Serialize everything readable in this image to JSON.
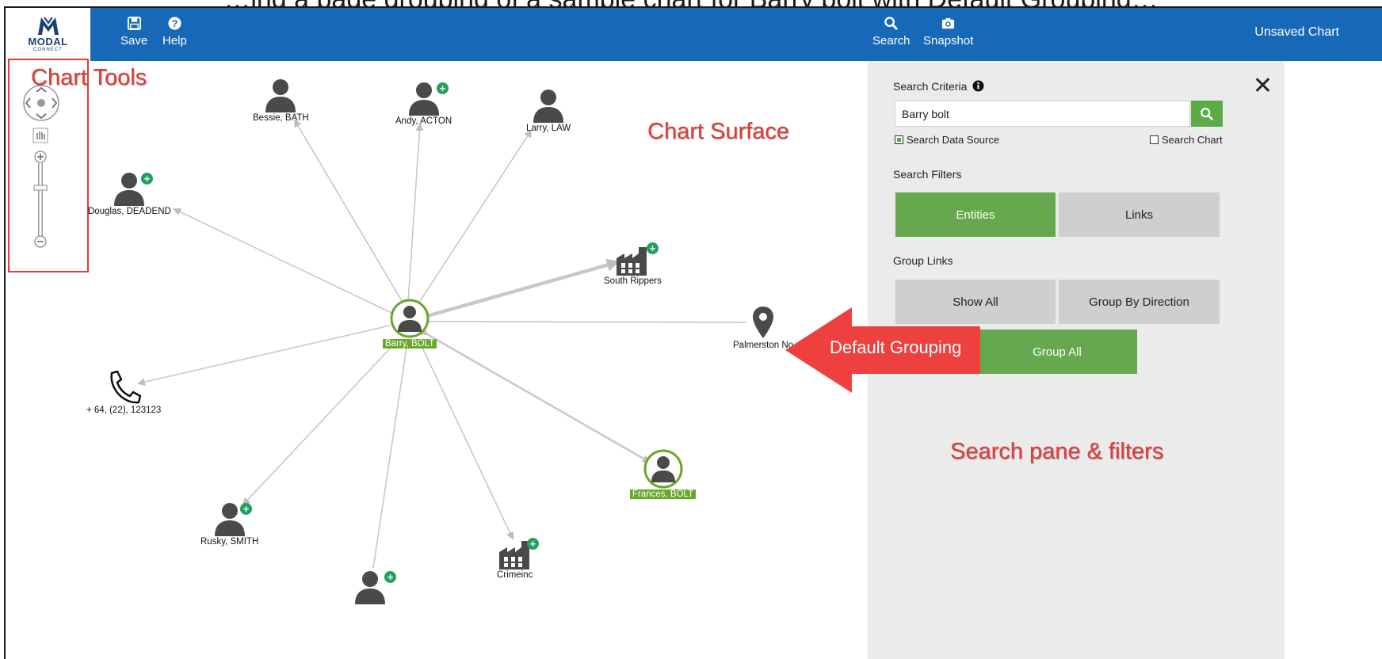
{
  "caption": "…ing a page grouping of a sample chart for Barry bolt with Default Grouping…",
  "app": {
    "logo_text": "MODAL",
    "logo_sub": "CONNECT",
    "chart_title": "Unsaved Chart"
  },
  "toolbar": {
    "save_label": "Save",
    "help_label": "Help",
    "search_label": "Search",
    "snapshot_label": "Snapshot"
  },
  "annotations": {
    "chart_tools": "Chart Tools",
    "chart_surface": "Chart Surface",
    "default_grouping": "Default Grouping",
    "search_pane": "Search pane & filters"
  },
  "nodes": {
    "barry": "Barry, BOLT",
    "bessie": "Bessie, BATH",
    "andy": "Andy, ACTON",
    "larry": "Larry, LAW",
    "douglas": "Douglas, DEADEND",
    "south_rippers": "South Rippers",
    "palmerston": "Palmerston No",
    "phone": "+ 64, (22), 123123",
    "frances": "Frances, BOLT",
    "rusky": "Rusky, SMITH",
    "crimeinc": "Crimeinc"
  },
  "search_pane": {
    "criteria_label": "Search Criteria",
    "query_value": "Barry bolt",
    "data_source_label": "Search Data Source",
    "data_source_checked": true,
    "chart_label": "Search Chart",
    "chart_checked": false,
    "filters_label": "Search Filters",
    "entities_label": "Entities",
    "links_label": "Links",
    "group_links_label": "Group Links",
    "show_all_label": "Show All",
    "group_direction_label": "Group By Direction",
    "group_all_label": "Group All"
  },
  "colors": {
    "toolbar": "#1868b8",
    "accent_green": "#66a84e",
    "annotation_red": "#e53935",
    "selected_green": "#6aa82a"
  }
}
